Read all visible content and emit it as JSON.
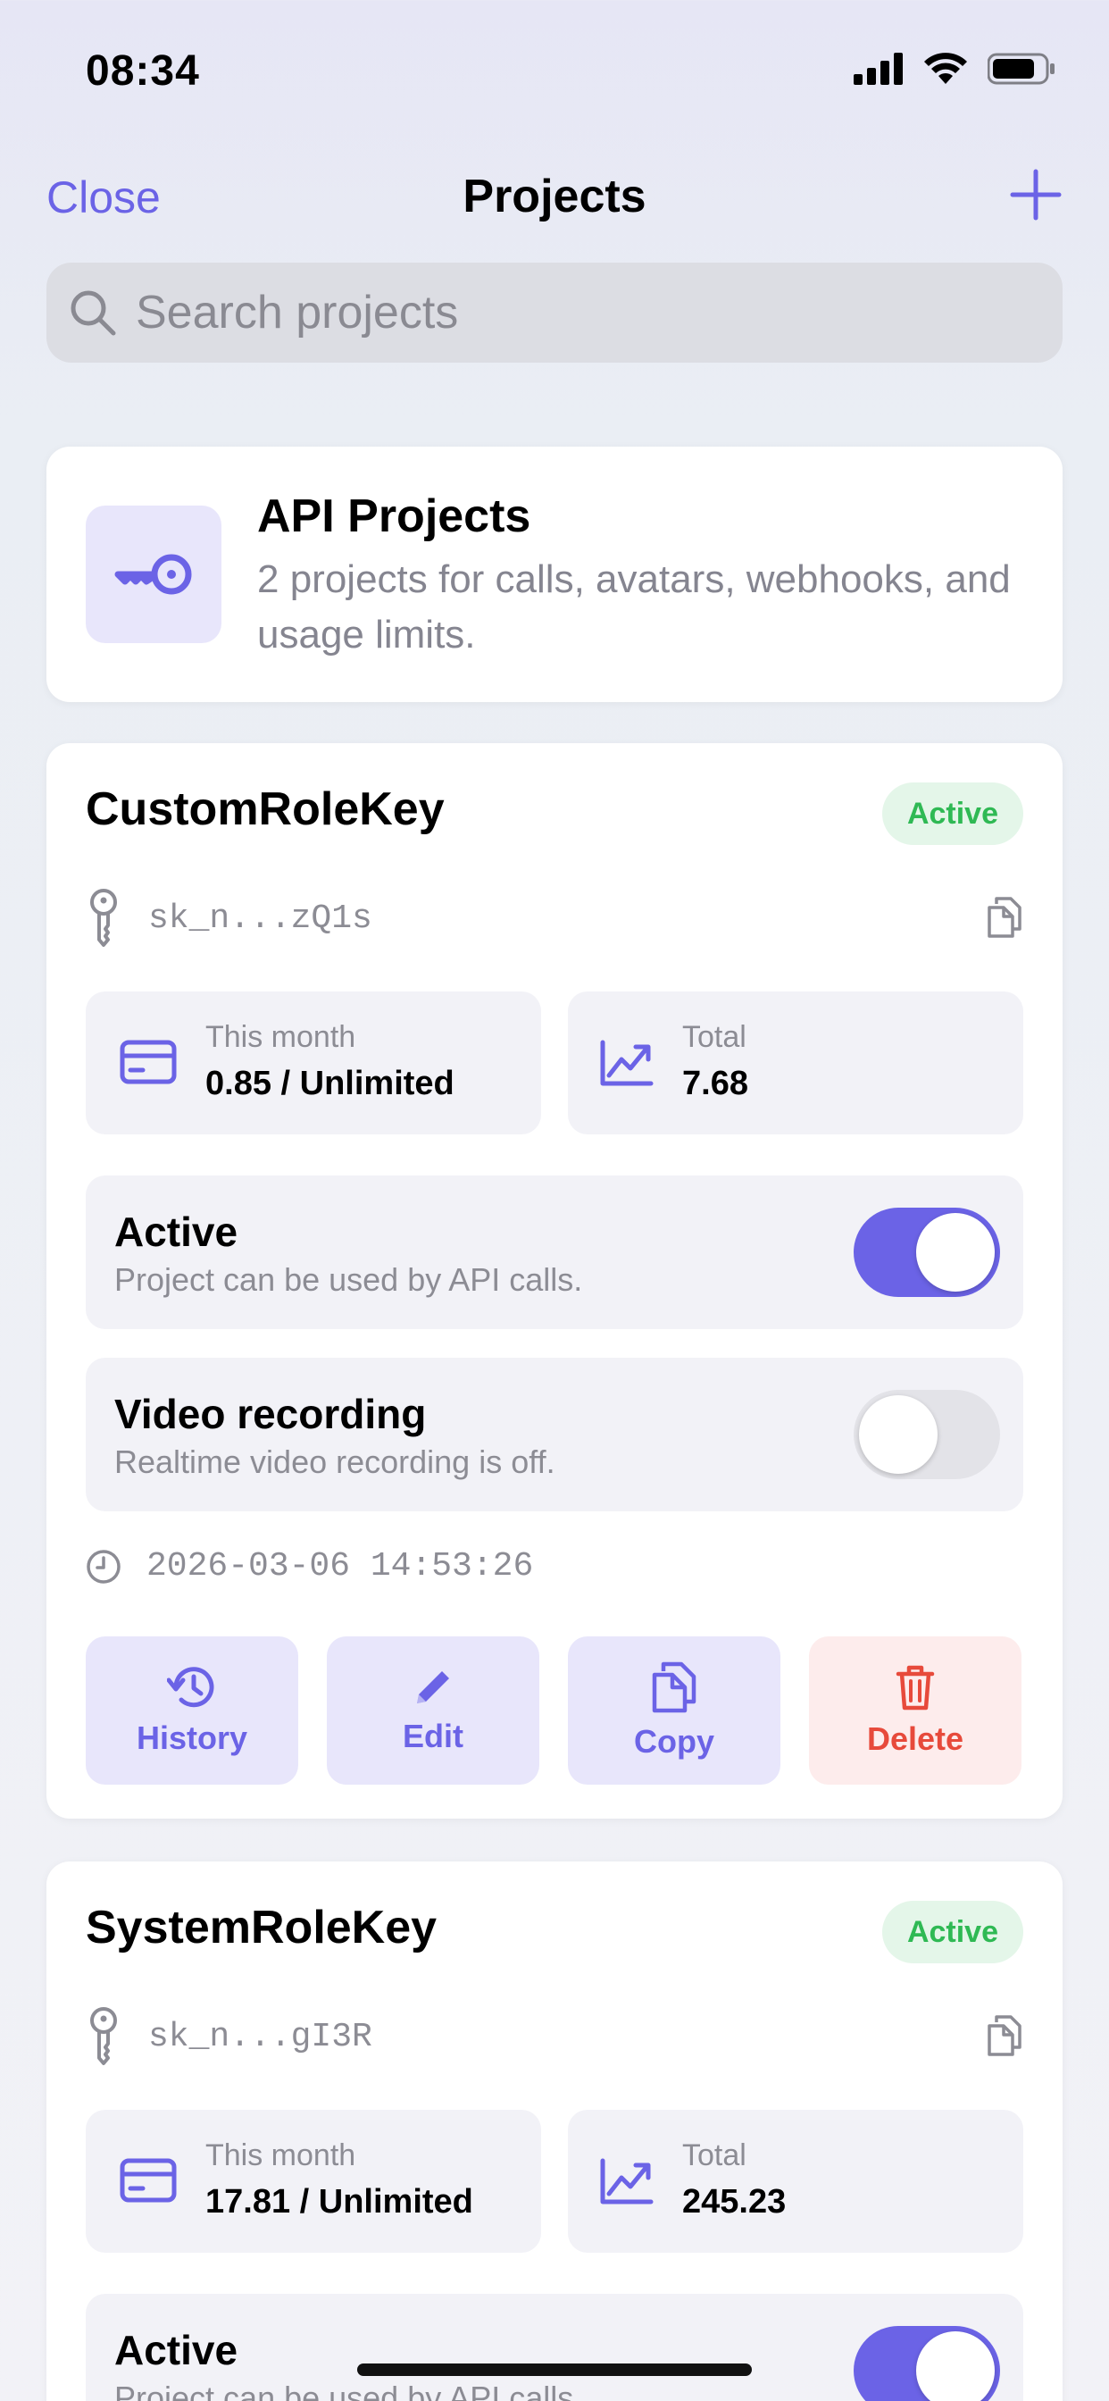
{
  "status_bar": {
    "time": "08:34"
  },
  "nav": {
    "close_label": "Close",
    "title": "Projects",
    "add_icon": "plus-icon"
  },
  "search": {
    "placeholder": "Search projects"
  },
  "summary": {
    "title": "API Projects",
    "subtitle": "2 projects for calls, avatars, webhooks, and usage limits.",
    "icon": "key-icon"
  },
  "projects": [
    {
      "name": "CustomRoleKey",
      "status": "Active",
      "key_masked": "sk_n...zQ1s",
      "this_month_label": "This month",
      "this_month_value": "0.85 / Unlimited",
      "total_label": "Total",
      "total_value": "7.68",
      "active_title": "Active",
      "active_desc": "Project can be used by API calls.",
      "active_on": true,
      "video_title": "Video recording",
      "video_desc": "Realtime video recording is off.",
      "video_on": false,
      "timestamp": "2026-03-06 14:53:26",
      "actions": {
        "history": "History",
        "edit": "Edit",
        "copy": "Copy",
        "delete": "Delete"
      }
    },
    {
      "name": "SystemRoleKey",
      "status": "Active",
      "key_masked": "sk_n...gI3R",
      "this_month_label": "This month",
      "this_month_value": "17.81 / Unlimited",
      "total_label": "Total",
      "total_value": "245.23",
      "active_title": "Active",
      "active_desc": "Project can be used by API calls.",
      "active_on": true
    }
  ],
  "colors": {
    "accent": "#6b63e6",
    "active_green": "#2fb954",
    "delete_red": "#e74a3b"
  }
}
